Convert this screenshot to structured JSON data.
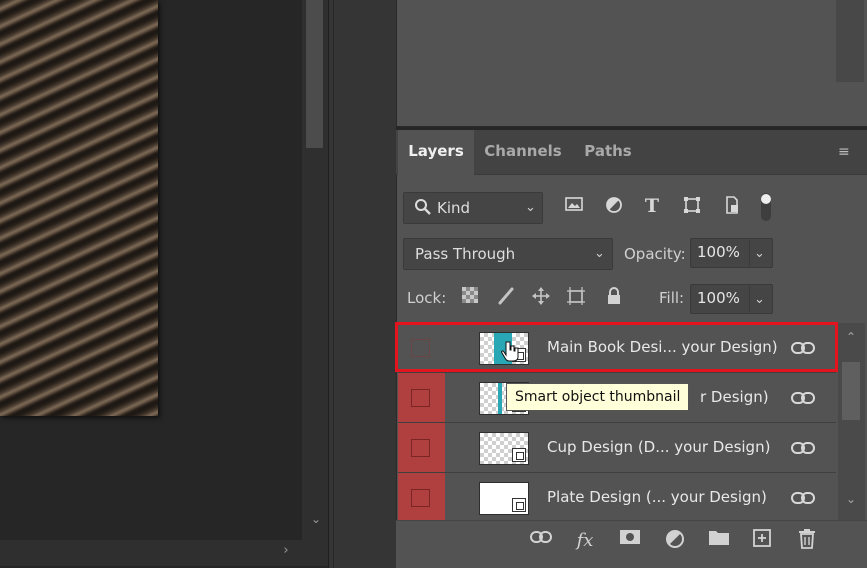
{
  "tabs": {
    "layers": "Layers",
    "channels": "Channels",
    "paths": "Paths"
  },
  "filter": {
    "kind_label": "Kind"
  },
  "blend": {
    "mode": "Pass Through",
    "opacity_label": "Opacity:",
    "opacity_value": "100%"
  },
  "lock": {
    "label": "Lock:",
    "fill_label": "Fill:",
    "fill_value": "100%"
  },
  "layers": [
    {
      "name": "Main Book Desi... your Design)",
      "thumb_color": "#2aa7b5",
      "selected": true
    },
    {
      "name": "r Design)",
      "thumb_color": "#2aa7b5",
      "selected": false
    },
    {
      "name": "Cup Design (D... your Design)",
      "thumb_color": "",
      "selected": false
    },
    {
      "name": "Plate Design (... your Design)",
      "thumb_color": "",
      "selected": false
    }
  ],
  "tooltip": "Smart object thumbnail",
  "colors": {
    "panel": "#535353",
    "visibility_cell": "#b04040",
    "highlight": "#e3141e",
    "tooltip_bg": "#ffffd9"
  },
  "icons": {
    "filter": [
      "search-icon",
      "image-filter-icon",
      "adjustment-filter-icon",
      "type-filter-icon",
      "shape-filter-icon",
      "smart-object-filter-icon",
      "filter-toggle-icon"
    ],
    "lock": [
      "lock-transparent-pixels-icon",
      "lock-image-pixels-icon",
      "lock-position-icon",
      "lock-artboard-icon",
      "lock-all-icon"
    ],
    "bottom": [
      "link-layers-icon",
      "fx-icon",
      "layer-mask-icon",
      "adjustment-layer-icon",
      "new-group-icon",
      "new-layer-icon",
      "delete-icon"
    ]
  }
}
